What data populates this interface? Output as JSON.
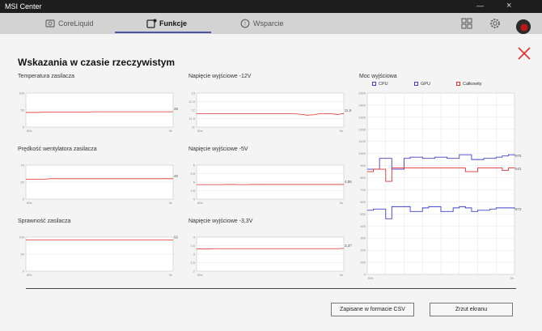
{
  "window": {
    "title": "MSI Center"
  },
  "nav": {
    "tabs": [
      {
        "label": "CoreLiquid",
        "active": false
      },
      {
        "label": "Funkcje",
        "active": true
      },
      {
        "label": "Wsparcie",
        "active": false
      }
    ]
  },
  "page": {
    "title": "Wskazania w czasie rzeczywistym",
    "csv_button": "Zapisane w formacie CSV",
    "screenshot_button": "Zrzut ekranu"
  },
  "colors": {
    "accent": "#4a55a8",
    "red_line": "#e03030",
    "blue_line": "#4040c8",
    "close": "#e03030"
  },
  "chart_data": [
    {
      "type": "line",
      "title": "Temperatura zasilacza",
      "yticks": [
        "100",
        "50",
        "0"
      ],
      "ylim": [
        0,
        100
      ],
      "xlabels": [
        "60s",
        "0s"
      ],
      "series": [
        {
          "values": [
            43,
            43,
            43,
            44,
            44,
            44,
            44,
            44,
            44,
            44,
            44,
            45,
            45,
            45,
            45,
            45,
            45,
            45,
            45,
            45,
            45,
            45,
            45,
            45,
            45
          ]
        }
      ],
      "end_label": "45"
    },
    {
      "type": "line",
      "title": "Napięcie wyjściowe -12V",
      "yticks": [
        "13",
        "12.5",
        "12",
        "11.5",
        "11"
      ],
      "ylim": [
        11,
        13
      ],
      "xlabels": [
        "60s",
        "0s"
      ],
      "series": [
        {
          "values": [
            11.78,
            11.78,
            11.78,
            11.78,
            11.78,
            11.78,
            11.78,
            11.78,
            11.78,
            11.78,
            11.78,
            11.78,
            11.78,
            11.78,
            11.78,
            11.78,
            11.78,
            11.75,
            11.7,
            11.72,
            11.78,
            11.78,
            11.78,
            11.74,
            11.8
          ]
        }
      ],
      "end_label": "11,9"
    },
    {
      "type": "line",
      "title": "Moc wyjściowa",
      "yticks": [
        "1500",
        "1400",
        "1300",
        "1200",
        "1100",
        "1000",
        "900",
        "800",
        "700",
        "600",
        "500",
        "400",
        "300",
        "200",
        "100",
        "0"
      ],
      "ylim": [
        0,
        1500
      ],
      "xlabels": [
        "60s",
        "0s"
      ],
      "legend": [
        "CPU",
        "GPU",
        "Całkowity"
      ],
      "series": [
        {
          "name": "CPU",
          "color": "#4040c8",
          "values": [
            870,
            870,
            960,
            960,
            870,
            870,
            960,
            970,
            970,
            960,
            960,
            970,
            970,
            960,
            960,
            990,
            990,
            950,
            950,
            960,
            960,
            970,
            980,
            990,
            980
          ]
        },
        {
          "name": "GPU",
          "color": "#4040c8",
          "values": [
            530,
            540,
            540,
            460,
            560,
            560,
            560,
            520,
            520,
            550,
            560,
            560,
            520,
            520,
            550,
            560,
            550,
            520,
            530,
            530,
            540,
            550,
            550,
            550,
            540
          ]
        },
        {
          "name": "Całkowity",
          "color": "#e03030",
          "values": [
            850,
            870,
            870,
            770,
            880,
            880,
            880,
            880,
            880,
            880,
            880,
            880,
            880,
            880,
            880,
            880,
            850,
            850,
            880,
            880,
            880,
            880,
            860,
            880,
            875
          ]
        }
      ],
      "end_labels": [
        "975",
        "872",
        "541"
      ]
    },
    {
      "type": "line",
      "title": "Prędkość wentylatora zasilacza",
      "yticks": [
        "70",
        "50",
        "0"
      ],
      "ylim": [
        0,
        70
      ],
      "xlabels": [
        "60s",
        "0s"
      ],
      "series": [
        {
          "values": [
            41,
            41,
            41,
            41,
            42,
            42,
            42,
            42,
            42,
            42,
            42,
            42,
            42,
            42,
            42,
            42,
            42,
            42,
            42,
            42,
            42,
            42,
            42,
            42,
            42
          ]
        }
      ],
      "end_label": "46"
    },
    {
      "type": "line",
      "title": "Napięcie wyjściowe -5V",
      "yticks": [
        "6",
        "5.5",
        "5",
        "4.5",
        "4"
      ],
      "ylim": [
        4,
        6
      ],
      "xlabels": [
        "60s",
        "0s"
      ],
      "series": [
        {
          "values": [
            4.85,
            4.85,
            4.85,
            4.85,
            4.85,
            4.86,
            4.86,
            4.85,
            4.85,
            4.86,
            4.86,
            4.86,
            4.86,
            4.86,
            4.86,
            4.86,
            4.86,
            4.86,
            4.86,
            4.86,
            4.86,
            4.86,
            4.86,
            4.86,
            4.86
          ]
        }
      ],
      "end_label": "4,86"
    },
    {
      "type": "line",
      "title": "Sprawność zasilacza",
      "yticks": [
        "100",
        "50",
        "0"
      ],
      "ylim": [
        0,
        100
      ],
      "xlabels": [
        "60s",
        "0s"
      ],
      "series": [
        {
          "values": [
            92,
            92,
            92,
            92,
            92,
            92,
            92,
            92,
            92,
            92,
            92,
            92,
            92,
            92,
            92,
            92,
            92,
            92,
            92,
            92,
            92,
            92,
            92,
            92,
            92
          ]
        }
      ],
      "end_label": "92"
    },
    {
      "type": "line",
      "title": "Napięcie wyjściowe -3,3V",
      "yticks": [
        "4",
        "3.5",
        "3",
        "2.5",
        "2"
      ],
      "ylim": [
        2,
        4
      ],
      "xlabels": [
        "60s",
        "0s"
      ],
      "series": [
        {
          "values": [
            3.3,
            3.3,
            3.3,
            3.32,
            3.32,
            3.32,
            3.32,
            3.32,
            3.32,
            3.32,
            3.32,
            3.32,
            3.32,
            3.32,
            3.32,
            3.32,
            3.32,
            3.32,
            3.32,
            3.32,
            3.32,
            3.32,
            3.32,
            3.32,
            3.34
          ]
        }
      ],
      "end_label": "3,37"
    }
  ]
}
